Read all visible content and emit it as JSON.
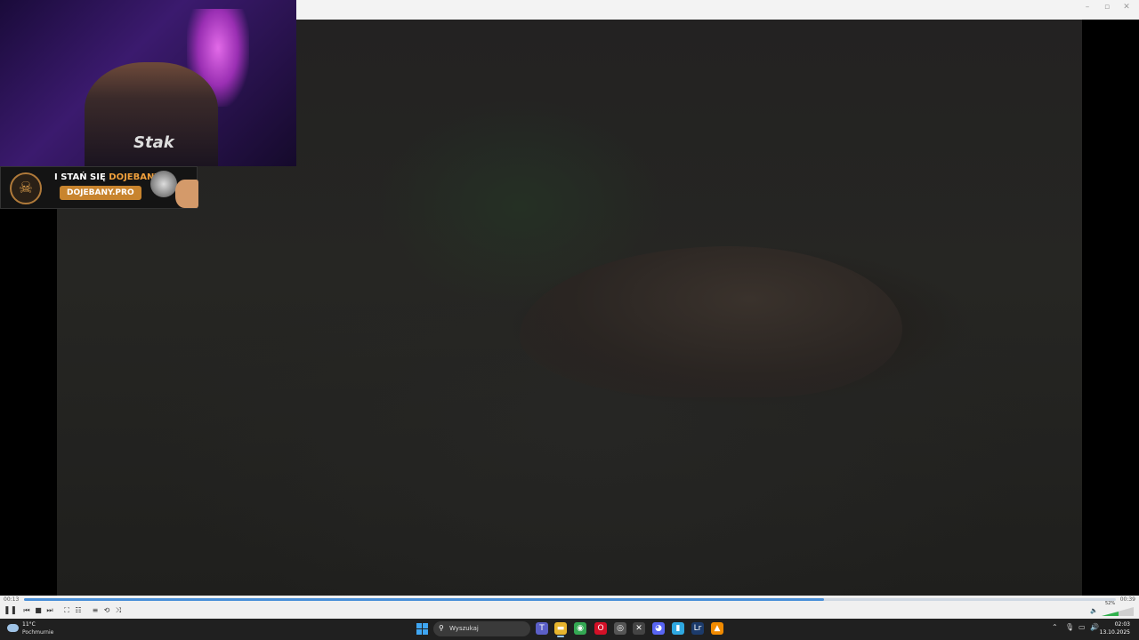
{
  "window": {
    "minimize": "–",
    "maximize": "▫",
    "close": "✕"
  },
  "webcam": {
    "shirt_text": "Stak"
  },
  "promo": {
    "line1_prefix": "I STAŃ SIĘ ",
    "line1_accent": "DOJEBANY",
    "url": "DOJEBANY.PRO",
    "logo_glyph": "☠"
  },
  "player": {
    "time_elapsed": "00:13",
    "time_total": "00:39",
    "progress_fraction": 0.733,
    "volume_label": "52%",
    "volume_fraction": 0.52,
    "buttons": {
      "pause": "❚❚",
      "prev": "⏮",
      "stop": "■",
      "next": "⏭",
      "fullscreen": "⛶",
      "extended": "☷",
      "playlist": "≡",
      "loop": "⟲",
      "shuffle": "⤨"
    },
    "speaker": "🔈"
  },
  "taskbar": {
    "weather_temp": "11°C",
    "weather_cond": "Pochmurnie",
    "search_placeholder": "Wyszukaj",
    "search_icon": "⚲",
    "apps": [
      {
        "name": "teams-icon",
        "glyph": "T",
        "color": "#5b5fc7"
      },
      {
        "name": "file-explorer-icon",
        "glyph": "▬",
        "color": "#e8b52e"
      },
      {
        "name": "chrome-icon",
        "glyph": "◉",
        "color": "#34a853"
      },
      {
        "name": "opera-icon",
        "glyph": "O",
        "color": "#d31027"
      },
      {
        "name": "app-circle-icon",
        "glyph": "◎",
        "color": "#555"
      },
      {
        "name": "app-x-icon",
        "glyph": "✕",
        "color": "#444"
      },
      {
        "name": "discord-icon",
        "glyph": "◕",
        "color": "#5865f2"
      },
      {
        "name": "docs-icon",
        "glyph": "▮",
        "color": "#2fa8e0"
      },
      {
        "name": "lightroom-icon",
        "glyph": "Lr",
        "color": "#1c3b6b"
      },
      {
        "name": "vlc-icon",
        "glyph": "▲",
        "color": "#f08a00"
      }
    ],
    "tray_chevron": "⌃",
    "tray_mic": "🎙",
    "tray_display": "▭",
    "tray_speaker": "🔊",
    "time": "02:03",
    "date": "13.10.2025"
  }
}
